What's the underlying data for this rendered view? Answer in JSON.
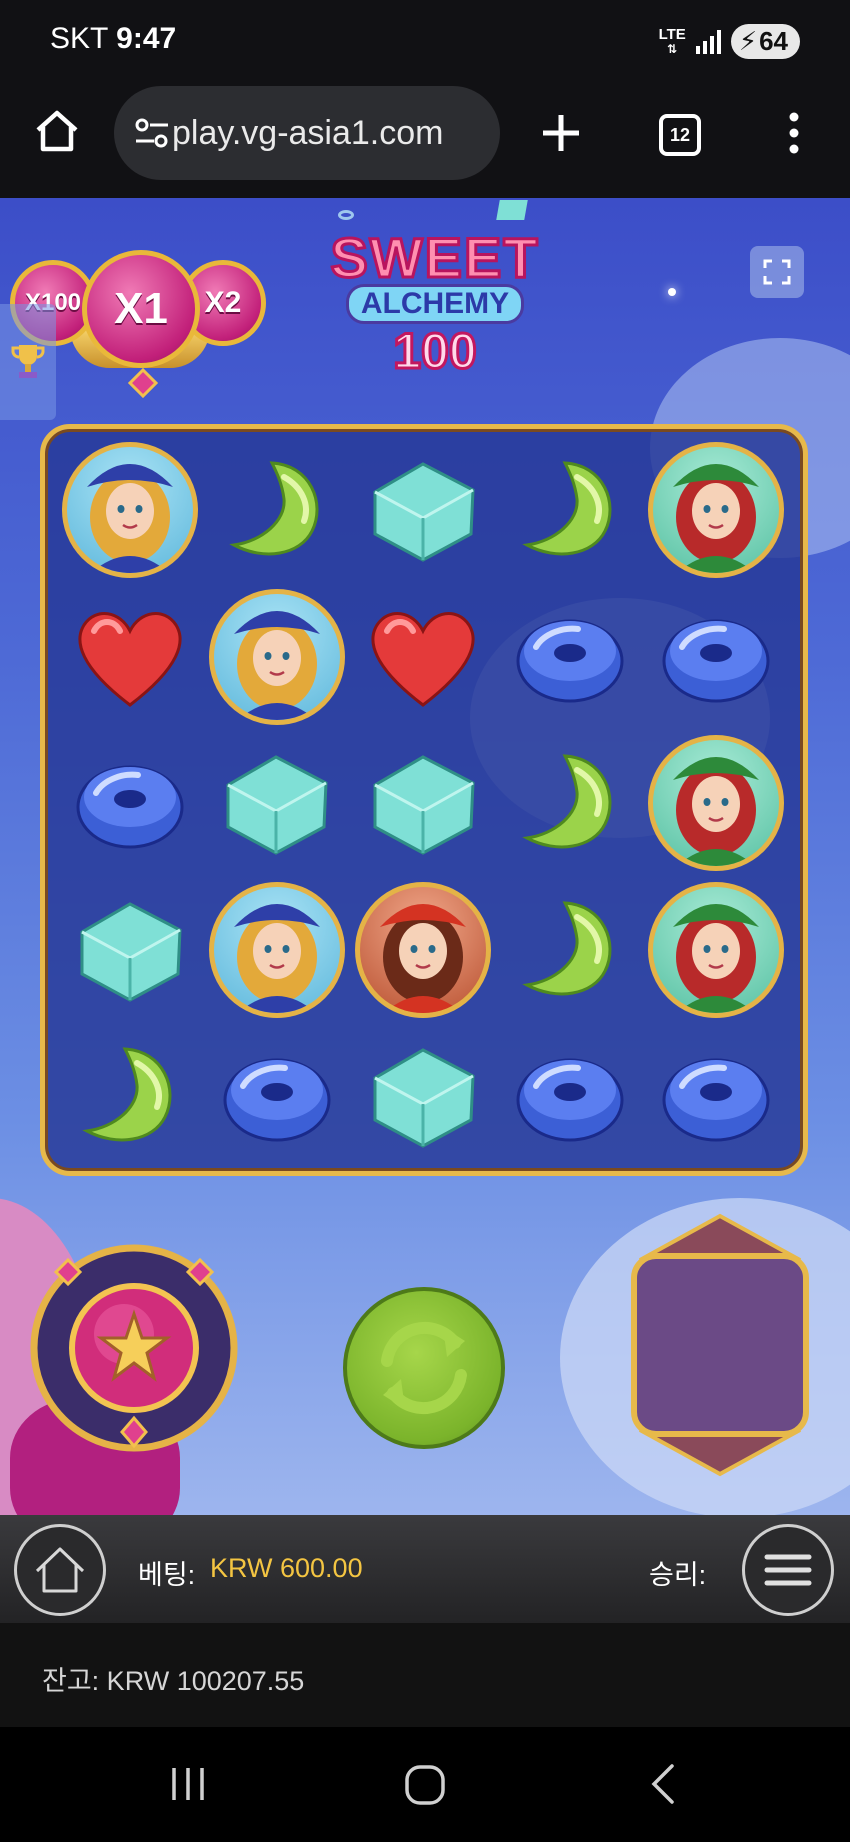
{
  "status_bar": {
    "carrier": "SKT",
    "time": "9:47",
    "network": "LTE",
    "battery_level": "64"
  },
  "browser": {
    "url_display": "play.vg-asia1.com",
    "tab_count": "12",
    "icons": [
      "home-icon",
      "site-settings-icon",
      "new-tab-icon",
      "tabs-icon",
      "more-vert-icon"
    ]
  },
  "game": {
    "title_line1": "SWEET",
    "title_line2": "ALCHEMY",
    "title_line3": "100",
    "multipliers": {
      "left": "X100",
      "active": "X1",
      "right": "X2"
    },
    "grid": [
      [
        "blonde-witch",
        "green-moon",
        "teal-cube",
        "green-moon",
        "redhead-witch"
      ],
      [
        "red-heart",
        "blonde-witch",
        "red-heart",
        "blue-donut",
        "blue-donut"
      ],
      [
        "blue-donut",
        "teal-cube",
        "teal-cube",
        "green-moon",
        "redhead-witch"
      ],
      [
        "teal-cube",
        "blonde-witch",
        "red-hat-girl",
        "green-moon",
        "redhead-witch"
      ],
      [
        "green-moon",
        "blue-donut",
        "teal-cube",
        "blue-donut",
        "blue-donut"
      ]
    ],
    "colors": {
      "heart": "#e43a3a",
      "moon": "#9bd34a",
      "cube": "#7fe0d6",
      "donut": "#3c5fd6",
      "frame_gold": "#e7b94a",
      "spin_green": "#7bb42b",
      "win_box_purple": "#6b4a86"
    }
  },
  "bottom_bar": {
    "bet_label": "베팅:",
    "bet_value": "KRW 600.00",
    "win_label": "승리:",
    "balance_text": "잔고: KRW 100207.55"
  },
  "nav": {
    "icons": [
      "recents-icon",
      "home-circle-icon",
      "back-icon"
    ]
  }
}
